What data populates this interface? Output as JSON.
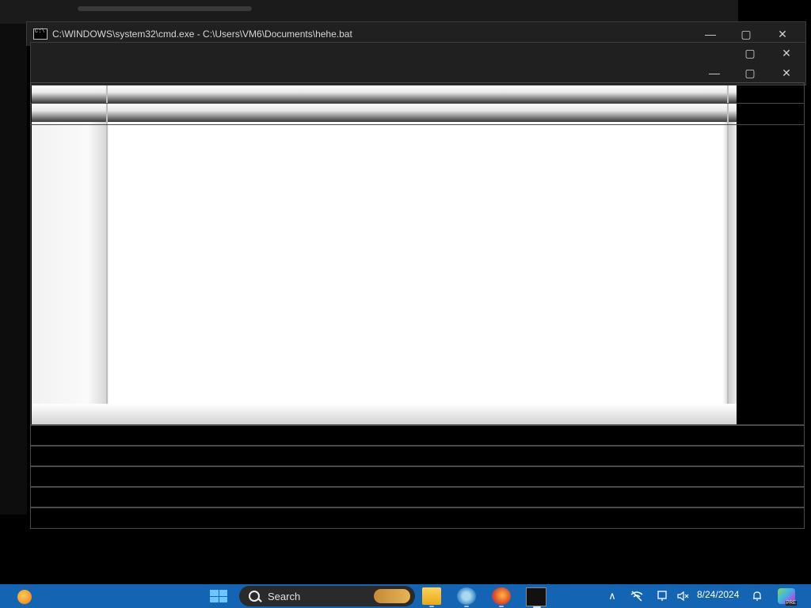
{
  "cmd_window": {
    "title": "C:\\WINDOWS\\system32\\cmd.exe - C:\\Users\\VM6\\Documents\\hehe.bat",
    "minimize_glyph": "—",
    "maximize_glyph": "▢",
    "close_glyph": "✕"
  },
  "taskbar": {
    "search_label": "Search",
    "date": "8/24/2024",
    "time_partial": "",
    "icons": {
      "widgets": "weather-widget-icon",
      "start": "windows-start-icon",
      "file_explorer": "folder-icon",
      "settings": "gear-icon",
      "browser": "firefox-icon",
      "terminal": "terminal-icon",
      "overflow": "chevron-up-icon",
      "network": "network-off-icon",
      "display": "display-icon",
      "volume": "volume-muted-icon",
      "notifications": "bell-icon",
      "badge_app": "app-preview-icon"
    },
    "tray_glyphs": {
      "overflow": "∧",
      "notifications": "🔔"
    }
  }
}
